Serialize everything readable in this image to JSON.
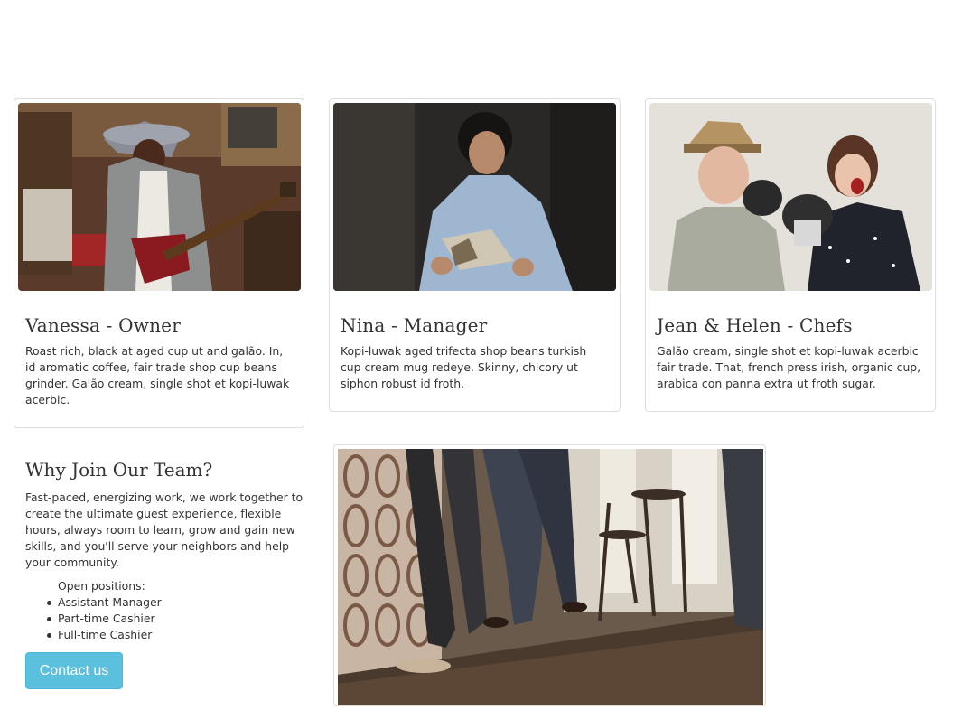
{
  "team": [
    {
      "title": "Vanessa - Owner",
      "text": "Roast rich, black at aged cup ut and galão. In, id aromatic coffee, fair trade shop cup beans grinder. Galão cream, single shot et kopi-luwak acerbic.",
      "image_alt": "woman-playing-guitar-photo"
    },
    {
      "title": "Nina - Manager",
      "text": "Kopi-luwak aged trifecta shop beans turkish cup cream mug redeye. Skinny, chicory ut siphon robust id froth.",
      "image_alt": "woman-reading-photo"
    },
    {
      "title": "Jean & Helen - Chefs",
      "text": "Galão cream, single shot et kopi-luwak acerbic fair trade. That, french press irish, organic cup, arabica con panna extra ut froth sugar.",
      "image_alt": "boxing-couple-photo"
    }
  ],
  "join": {
    "heading": "Why Join Our Team?",
    "text": "Fast-paced, energizing work, we work together to create the ultimate guest experience, flexible hours, always room to learn, grow and gain new skills, and you'll serve your neighbors and help your community.",
    "positions_label": "Open positions:",
    "positions": [
      "Assistant Manager",
      "Part-time Cashier",
      "Full-time Cashier"
    ],
    "button_label": "Contact us"
  },
  "colors": {
    "button_bg": "#5bc0de",
    "text": "#333333",
    "border": "#dddddd"
  }
}
